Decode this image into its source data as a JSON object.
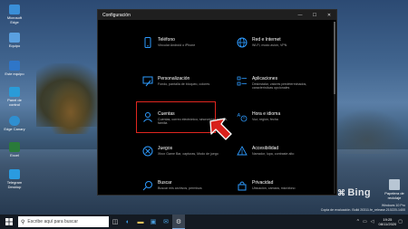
{
  "desktop": {
    "icons": [
      {
        "label": "Microsoft Edge"
      },
      {
        "label": "Equipo"
      },
      {
        "label": "Este equipo"
      },
      {
        "label": "Panel de control"
      },
      {
        "label": "Edge Canary"
      },
      {
        "label": "Excel"
      },
      {
        "label": "Telegram Desktop"
      }
    ],
    "recycle_label": "Papelera de reciclaje",
    "bing": "Bing",
    "watermark": {
      "line1": "Windows 10 Pro",
      "line2": "Copia de evaluación. Build 20311.fe_release.210220-1400",
      "time": "19:25",
      "date": "08/11/2020"
    }
  },
  "window": {
    "title": "Configuración",
    "controls": {
      "minimize": "—",
      "maximize": "☐",
      "close": "✕"
    },
    "tiles": [
      {
        "title": "Teléfono",
        "desc": "Vincular Android o iPhone"
      },
      {
        "title": "Red e Internet",
        "desc": "Wi-Fi, modo avión, VPN"
      },
      {
        "title": "Personalización",
        "desc": "Fondo, pantalla de bloqueo, colores"
      },
      {
        "title": "Aplicaciones",
        "desc": "Desinstalar, valores predeterminados, características opcionales"
      },
      {
        "title": "Cuentas",
        "desc": "Cuentas, correo electrónico, sincronizar, trabajo, familia"
      },
      {
        "title": "Hora e idioma",
        "desc": "Voz, región, fecha"
      },
      {
        "title": "Juegos",
        "desc": "Xbox Game Bar, capturas, Modo de juego"
      },
      {
        "title": "Accesibilidad",
        "desc": "Narrador, lupa, contraste alto"
      },
      {
        "title": "Buscar",
        "desc": "Buscar mis archivos, permisos"
      },
      {
        "title": "Privacidad",
        "desc": "Ubicación, cámara, micrófono"
      }
    ]
  },
  "taskbar": {
    "search_placeholder": "Escribe aquí para buscar",
    "time": "19:25",
    "date": "08/11/2020"
  },
  "colors": {
    "accent": "#2e9bff",
    "highlight": "#e0261f"
  }
}
